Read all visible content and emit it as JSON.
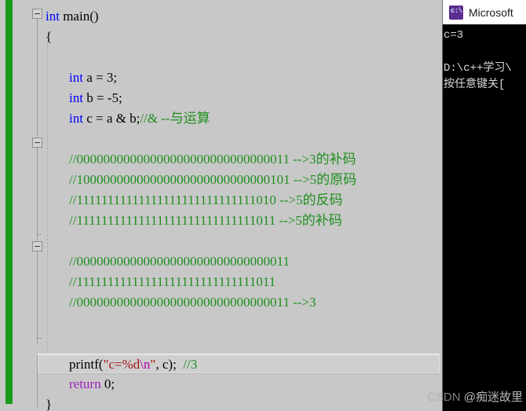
{
  "editor": {
    "language": "c",
    "colors": {
      "background": "#c8c8c8",
      "keyword": "#0000ff",
      "keyword2": "#a020c0",
      "comment": "#1f8f1f",
      "string": "#a31515",
      "escape": "#b000b0",
      "change_bar": "#1a9c1a",
      "current_line": "#cfcfcf"
    },
    "lines": [
      {
        "indent": 0,
        "tokens": [
          {
            "t": "int",
            "c": "kw"
          },
          {
            "t": " main()",
            "c": "plain"
          }
        ]
      },
      {
        "indent": 0,
        "tokens": [
          {
            "t": "{",
            "c": "plain"
          }
        ]
      },
      {
        "indent": 1,
        "tokens": []
      },
      {
        "indent": 1,
        "tokens": [
          {
            "t": "int",
            "c": "kw"
          },
          {
            "t": " a = 3;",
            "c": "plain"
          }
        ]
      },
      {
        "indent": 1,
        "tokens": [
          {
            "t": "int",
            "c": "kw"
          },
          {
            "t": " b = -5;",
            "c": "plain"
          }
        ]
      },
      {
        "indent": 1,
        "tokens": [
          {
            "t": "int",
            "c": "kw"
          },
          {
            "t": " c = a & b;",
            "c": "plain"
          },
          {
            "t": "//& --与运算",
            "c": "cmt"
          }
        ]
      },
      {
        "indent": 1,
        "tokens": []
      },
      {
        "indent": 1,
        "tokens": [
          {
            "t": "//00000000000000000000000000000011 -->3的补码",
            "c": "cmt"
          }
        ]
      },
      {
        "indent": 1,
        "tokens": [
          {
            "t": "//10000000000000000000000000000101 -->5的原码",
            "c": "cmt"
          }
        ]
      },
      {
        "indent": 1,
        "tokens": [
          {
            "t": "//11111111111111111111111111111010 -->5的反码",
            "c": "cmt"
          }
        ]
      },
      {
        "indent": 1,
        "tokens": [
          {
            "t": "//11111111111111111111111111111011 -->5的补码",
            "c": "cmt"
          }
        ]
      },
      {
        "indent": 1,
        "tokens": []
      },
      {
        "indent": 1,
        "tokens": [
          {
            "t": "//00000000000000000000000000000011",
            "c": "cmt"
          }
        ]
      },
      {
        "indent": 1,
        "tokens": [
          {
            "t": "//11111111111111111111111111111011",
            "c": "cmt"
          }
        ]
      },
      {
        "indent": 1,
        "tokens": [
          {
            "t": "//00000000000000000000000000000011 -->3",
            "c": "cmt"
          }
        ]
      },
      {
        "indent": 1,
        "tokens": []
      },
      {
        "indent": 1,
        "tokens": []
      },
      {
        "indent": 1,
        "current": true,
        "tokens": [
          {
            "t": "printf(",
            "c": "plain"
          },
          {
            "t": "\"c=%d",
            "c": "str"
          },
          {
            "t": "\\n",
            "c": "esc"
          },
          {
            "t": "\"",
            "c": "str"
          },
          {
            "t": ", c);  ",
            "c": "plain"
          },
          {
            "t": "//3",
            "c": "cmt"
          }
        ]
      },
      {
        "indent": 1,
        "tokens": [
          {
            "t": "return",
            "c": "kw2"
          },
          {
            "t": " 0;",
            "c": "plain"
          }
        ]
      },
      {
        "indent": 0,
        "tokens": [
          {
            "t": "}",
            "c": "plain"
          }
        ]
      }
    ]
  },
  "console": {
    "title": "Microsoft",
    "icon": "cmd-prompt-icon",
    "output_lines": [
      "c=3",
      "",
      "D:\\c++学习\\",
      "按任意键关[",
      ""
    ]
  },
  "watermark": {
    "brand": "CSDN ",
    "user": "@痴迷故里"
  }
}
